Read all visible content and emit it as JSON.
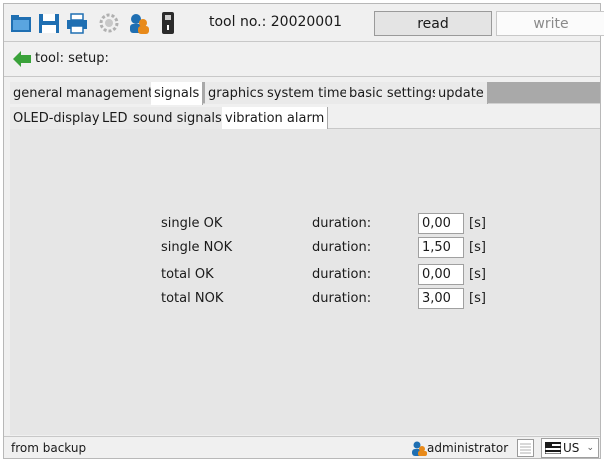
{
  "toolbar": {
    "tool_label": "tool no.: 20020001",
    "read_label": "read",
    "write_label": "write",
    "icons": [
      "folder-open-icon",
      "save-icon",
      "print-icon",
      "settings-gear-icon",
      "user-icon",
      "device-icon"
    ]
  },
  "breadcrumb": {
    "text": "tool: setup:"
  },
  "tabs_main": [
    "general",
    "management",
    "signals",
    "graphics",
    "system time",
    "basic settings",
    "update"
  ],
  "tabs_main_active": "signals",
  "tabs_sub": [
    "OLED-display",
    "LED",
    "sound signals",
    "vibration alarm"
  ],
  "tabs_sub_active": "vibration alarm",
  "vibration": {
    "rows": [
      {
        "label": "single OK",
        "duration_label": "duration:",
        "value": "0,00",
        "unit": "[s]"
      },
      {
        "label": "single NOK",
        "duration_label": "duration:",
        "value": "1,50",
        "unit": "[s]"
      },
      {
        "label": "total OK",
        "duration_label": "duration:",
        "value": "0,00",
        "unit": "[s]"
      },
      {
        "label": "total NOK",
        "duration_label": "duration:",
        "value": "3,00",
        "unit": "[s]"
      }
    ]
  },
  "status": {
    "text": "from backup",
    "user": "administrator",
    "language": "US"
  },
  "colors": {
    "content_bg": "#e6e6e6",
    "tab_strip": "#a9a9a9",
    "back_arrow": "#3aa23a",
    "user_icon": "#e88a1a"
  }
}
